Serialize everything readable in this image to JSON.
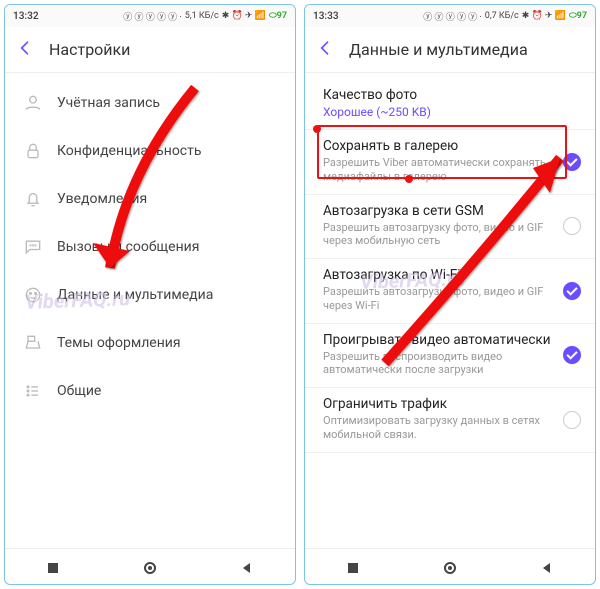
{
  "left": {
    "status": {
      "time": "13:32",
      "net": "5,1 КБ/с",
      "battery": "97"
    },
    "title": "Настройки",
    "items": [
      {
        "label": "Учётная запись",
        "icon": "user-icon"
      },
      {
        "label": "Конфиденциальность",
        "icon": "lock-icon"
      },
      {
        "label": "Уведомления",
        "icon": "bell-icon"
      },
      {
        "label": "Вызовы и сообщения",
        "icon": "chat-icon"
      },
      {
        "label": "Данные и мультимедиа",
        "icon": "media-icon"
      },
      {
        "label": "Темы оформления",
        "icon": "theme-icon"
      },
      {
        "label": "Общие",
        "icon": "list-icon"
      }
    ]
  },
  "right": {
    "status": {
      "time": "13:33",
      "net": "0,7 КБ/с",
      "battery": "97"
    },
    "title": "Данные и мультимедиа",
    "quality": {
      "label": "Качество фото",
      "value": "Хорошее (~250 KB)"
    },
    "rows": [
      {
        "title": "Сохранять в галерею",
        "sub": "Разрешить Viber автоматически сохранять медиафайлы в галерею",
        "on": true
      },
      {
        "title": "Автозагрузка в сети GSM",
        "sub": "Разрешить автозагрузку фото, видео и GIF через мобильную сеть",
        "on": false
      },
      {
        "title": "Автозагрузка по Wi-Fi",
        "sub": "Разрешить автозагрузку фото, видео и GIF через Wi-Fi",
        "on": true
      },
      {
        "title": "Проигрывать видео автоматически",
        "sub": "Разрешить воспроизводить видео автоматически после загрузки",
        "on": true
      },
      {
        "title": "Ограничить трафик",
        "sub": "Оптимизировать загрузку данных в сетях мобильной связи.",
        "on": false
      }
    ]
  },
  "watermark": "ViberFAQ.ru"
}
